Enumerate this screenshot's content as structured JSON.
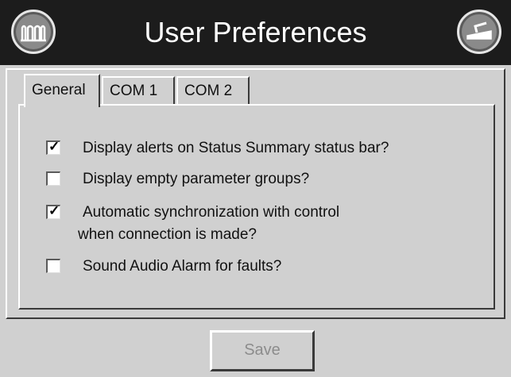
{
  "header": {
    "title": "User Preferences",
    "left_button_icon": "factory-icon",
    "right_button_icon": "exit-door-icon"
  },
  "tabs": [
    {
      "label": "General",
      "active": true
    },
    {
      "label": "COM 1",
      "active": false
    },
    {
      "label": "COM 2",
      "active": false
    }
  ],
  "options": [
    {
      "label": "Display alerts on Status Summary status bar?",
      "checked": true,
      "mark": "✓"
    },
    {
      "label": "Display empty parameter groups?",
      "checked": false,
      "mark": ""
    },
    {
      "label": "Automatic synchronization with control",
      "label_line2": "when connection is made?",
      "checked": true,
      "mark": "✓"
    },
    {
      "label": "Sound Audio Alarm for faults?",
      "checked": false,
      "mark": ""
    }
  ],
  "footer": {
    "save_label": "Save",
    "save_enabled": false
  },
  "colors": {
    "header_bg": "#1c1c1c",
    "panel_bg": "#d0d0d0",
    "title_text": "#ffffff",
    "disabled_text": "#8c8c8c"
  }
}
